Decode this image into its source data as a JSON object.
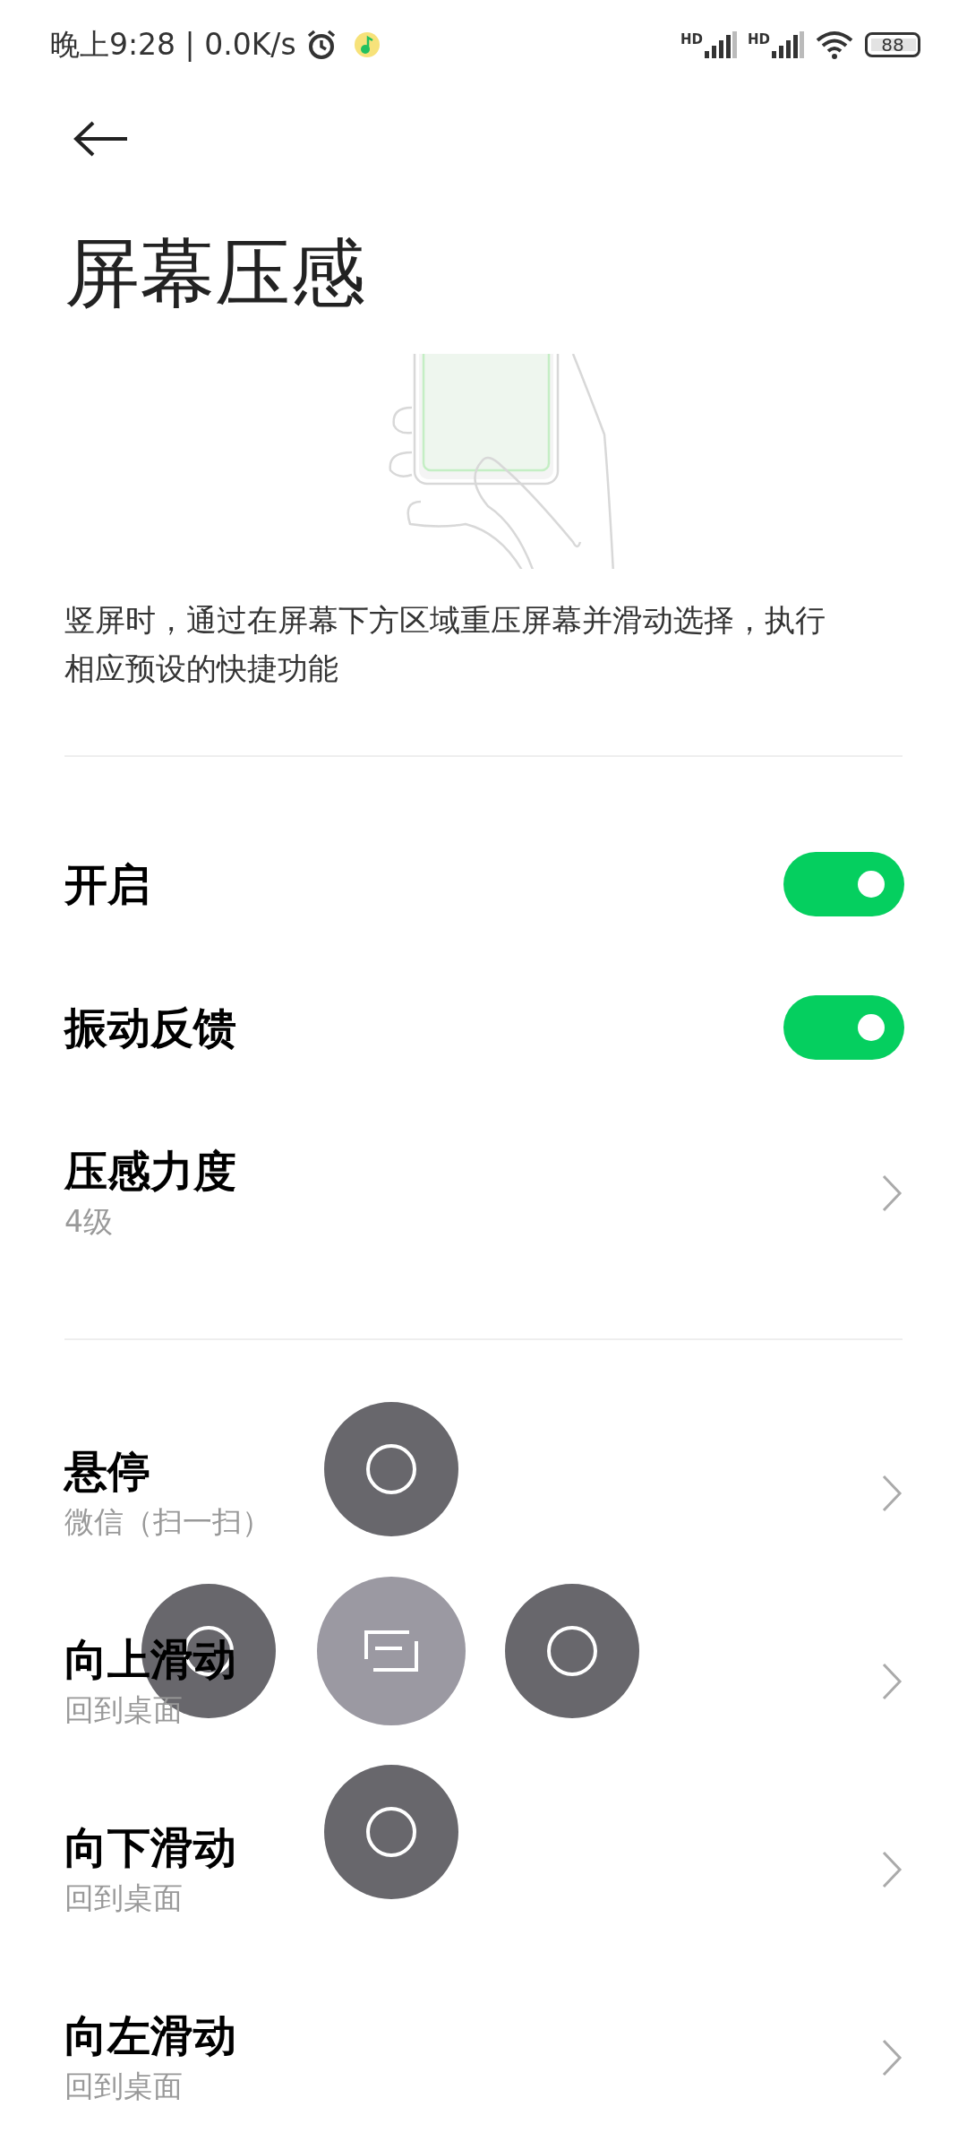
{
  "status_bar": {
    "time": "晚上9:28 | 0.0K/s",
    "signals": [
      {
        "label": "HD"
      },
      {
        "label": "HD"
      }
    ],
    "battery": "88"
  },
  "title": "屏幕压感",
  "description": "竖屏时，通过在屏幕下方区域重压屏幕并滑动选择，执行相应预设的快捷功能",
  "toggles": [
    {
      "label": "开启",
      "on": true
    },
    {
      "label": "振动反馈",
      "on": true
    }
  ],
  "strength": {
    "label": "压感力度",
    "value": "4级"
  },
  "gestures": [
    {
      "label": "悬停",
      "value": "微信（扫一扫）"
    },
    {
      "label": "向上滑动",
      "value": "回到桌面"
    },
    {
      "label": "向下滑动",
      "value": "回到桌面"
    },
    {
      "label": "向左滑动",
      "value": "回到桌面"
    }
  ],
  "overlay": {
    "top": {
      "kind": "ring",
      "selected": false
    },
    "left": {
      "kind": "ring",
      "selected": false
    },
    "center": {
      "kind": "recents",
      "selected": true
    },
    "right": {
      "kind": "ring",
      "selected": false
    },
    "bottom": {
      "kind": "ring",
      "selected": false
    }
  }
}
